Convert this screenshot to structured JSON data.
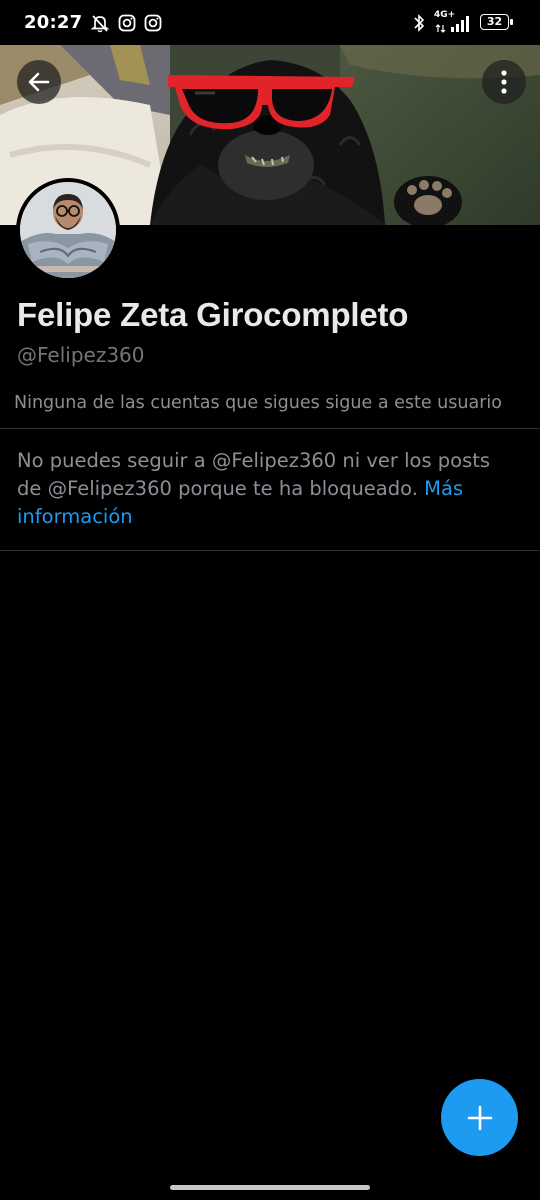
{
  "status_bar": {
    "time": "20:27",
    "network": "4G+",
    "battery": "32",
    "icons": [
      "mute-bell-icon",
      "instagram-icon",
      "instagram-icon",
      "bluetooth-icon",
      "signal-icon",
      "battery-icon"
    ]
  },
  "header": {
    "back_icon": "arrow-left-icon",
    "more_icon": "vertical-dots-icon"
  },
  "profile": {
    "display_name": "Felipe Zeta Girocompleto",
    "handle": "@Felipez360",
    "followers_note": "Ninguna de las cuentas que sigues sigue a este usuario"
  },
  "blocked": {
    "message": "No puedes seguir a @Felipez360 ni ver los posts de @Felipez360 porque te ha bloqueado. ",
    "link_text": "Más información"
  },
  "fab": {
    "icon": "plus-icon"
  },
  "colors": {
    "background": "#000000",
    "accent": "#1d9bf0",
    "muted_text": "#71767b",
    "divider": "#2f3336",
    "sunglasses": "#e0242a"
  }
}
